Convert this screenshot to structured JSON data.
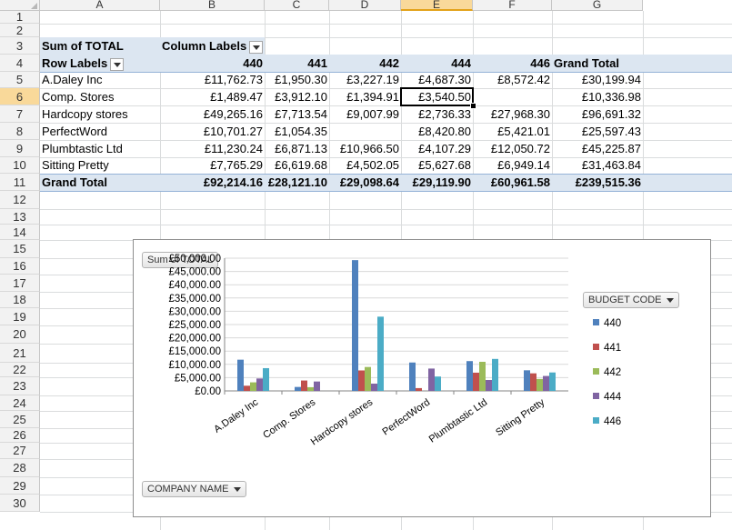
{
  "columns": [
    "A",
    "B",
    "C",
    "D",
    "E",
    "F",
    "G"
  ],
  "rows": [
    "1",
    "2",
    "3",
    "4",
    "5",
    "6",
    "7",
    "8",
    "9",
    "10",
    "11",
    "12",
    "13",
    "14",
    "15",
    "16",
    "17",
    "18",
    "19",
    "20",
    "21",
    "22",
    "23",
    "24",
    "25",
    "26",
    "27",
    "28",
    "29",
    "30"
  ],
  "pivot": {
    "measure_label": "Sum of TOTAL",
    "column_labels": "Column Labels",
    "row_labels": "Row Labels",
    "headers": [
      "440",
      "441",
      "442",
      "444",
      "446",
      "Grand Total"
    ],
    "rows": [
      {
        "label": "A.Daley Inc",
        "values": [
          "£11,762.73",
          "£1,950.30",
          "£3,227.19",
          "£4,687.30",
          "£8,572.42",
          "£30,199.94"
        ]
      },
      {
        "label": "Comp. Stores",
        "values": [
          "£1,489.47",
          "£3,912.10",
          "£1,394.91",
          "£3,540.50",
          "",
          "£10,336.98"
        ]
      },
      {
        "label": "Hardcopy stores",
        "values": [
          "£49,265.16",
          "£7,713.54",
          "£9,007.99",
          "£2,736.33",
          "£27,968.30",
          "£96,691.32"
        ]
      },
      {
        "label": "PerfectWord",
        "values": [
          "£10,701.27",
          "£1,054.35",
          "",
          "£8,420.80",
          "£5,421.01",
          "£25,597.43"
        ]
      },
      {
        "label": "Plumbtastic Ltd",
        "values": [
          "£11,230.24",
          "£6,871.13",
          "£10,966.50",
          "£4,107.29",
          "£12,050.72",
          "£45,225.87"
        ]
      },
      {
        "label": "Sitting Pretty",
        "values": [
          "£7,765.29",
          "£6,619.68",
          "£4,502.05",
          "£5,627.68",
          "£6,949.14",
          "£31,463.84"
        ]
      }
    ],
    "grand_total": {
      "label": "Grand Total",
      "values": [
        "£92,214.16",
        "£28,121.10",
        "£29,098.64",
        "£29,119.90",
        "£60,961.58",
        "£239,515.36"
      ]
    }
  },
  "chart_buttons": {
    "values_field": "Sum of TOTAL",
    "legend_field": "BUDGET CODE",
    "axis_field": "COMPANY NAME"
  },
  "chart_data": {
    "type": "bar",
    "categories": [
      "A.Daley Inc",
      "Comp. Stores",
      "Hardcopy stores",
      "PerfectWord",
      "Plumbtastic Ltd",
      "Sitting Pretty"
    ],
    "series": [
      {
        "name": "440",
        "color": "#4f81bd",
        "values": [
          11762.73,
          1489.47,
          49265.16,
          10701.27,
          11230.24,
          7765.29
        ]
      },
      {
        "name": "441",
        "color": "#c0504d",
        "values": [
          1950.3,
          3912.1,
          7713.54,
          1054.35,
          6871.13,
          6619.68
        ]
      },
      {
        "name": "442",
        "color": "#9bbb59",
        "values": [
          3227.19,
          1394.91,
          9007.99,
          0,
          10966.5,
          4502.05
        ]
      },
      {
        "name": "444",
        "color": "#8064a2",
        "values": [
          4687.3,
          3540.5,
          2736.33,
          8420.8,
          4107.29,
          5627.68
        ]
      },
      {
        "name": "446",
        "color": "#4bacc6",
        "values": [
          8572.42,
          0,
          27968.3,
          5421.01,
          12050.72,
          6949.14
        ]
      }
    ],
    "yticks": [
      "£0.00",
      "£5,000.00",
      "£10,000.00",
      "£15,000.00",
      "£20,000.00",
      "£25,000.00",
      "£30,000.00",
      "£35,000.00",
      "£40,000.00",
      "£45,000.00",
      "£50,000.00"
    ],
    "ylim": [
      0,
      50000
    ],
    "legend_position": "right",
    "grid": true
  }
}
